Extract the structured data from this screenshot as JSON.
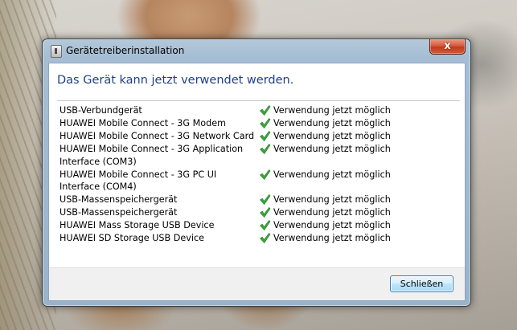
{
  "window": {
    "title": "Gerätetreiberinstallation",
    "close_glyph": "x",
    "icon": "device-installer-icon"
  },
  "heading": "Das Gerät kann jetzt verwendet werden.",
  "devices": [
    {
      "name": "USB-Verbundgerät",
      "status": "Verwendung jetzt möglich"
    },
    {
      "name": "HUAWEI Mobile Connect - 3G Modem",
      "status": "Verwendung jetzt möglich"
    },
    {
      "name": "HUAWEI Mobile Connect - 3G Network Card",
      "status": "Verwendung jetzt möglich"
    },
    {
      "name": "HUAWEI Mobile Connect - 3G Application Interface (COM3)",
      "status": "Verwendung jetzt möglich"
    },
    {
      "name": "HUAWEI Mobile Connect - 3G PC UI Interface (COM4)",
      "status": "Verwendung jetzt möglich"
    },
    {
      "name": "USB-Massenspeichergerät",
      "status": "Verwendung jetzt möglich"
    },
    {
      "name": "USB-Massenspeichergerät",
      "status": "Verwendung jetzt möglich"
    },
    {
      "name": "HUAWEI Mass Storage USB Device",
      "status": "Verwendung jetzt möglich"
    },
    {
      "name": "HUAWEI SD Storage USB Device",
      "status": "Verwendung jetzt möglich"
    }
  ],
  "status_icon": "green-checkmark-icon",
  "buttons": {
    "close_label": "Schließen"
  },
  "colors": {
    "heading": "#1e3f8a",
    "check": "#3aa63a",
    "close_button_red": "#c23a1c"
  }
}
